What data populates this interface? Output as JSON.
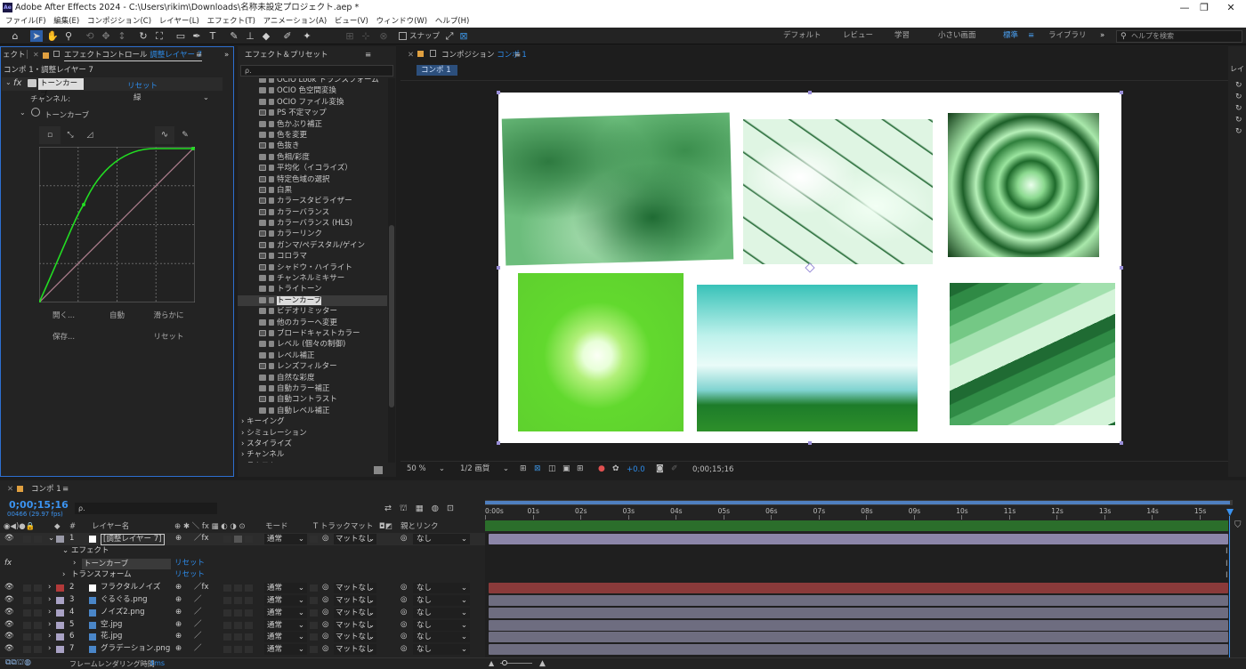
{
  "app": {
    "title": "Adobe After Effects 2024 - C:\\Users\\rikim\\Downloads\\名称未設定プロジェクト.aep *",
    "logo": "Ae"
  },
  "menu": [
    "ファイル(F)",
    "編集(E)",
    "コンポジション(C)",
    "レイヤー(L)",
    "エフェクト(T)",
    "アニメーション(A)",
    "ビュー(V)",
    "ウィンドウ(W)",
    "ヘルプ(H)"
  ],
  "toolbar": {
    "snap_label": "スナップ",
    "workspaces": [
      "デフォルト",
      "レビュー",
      "学習",
      "小さい画面",
      "標準",
      "ライブラリ"
    ],
    "search_placeholder": "ヘルプを検索",
    "more": "»"
  },
  "effect_controls": {
    "tab_prefix": "エフェクトコントロール",
    "tab_layer": "調整レイヤー 7",
    "menu_glyph": "≡",
    "left_tab": "ェクト",
    "collapse": "»",
    "breadcrumb": "コンポ 1・調整レイヤー 7",
    "effect_name": "トーンカーブ",
    "reset": "リセット",
    "channel_label": "チャンネル:",
    "channel_value": "緑",
    "curve_label": "トーンカーブ",
    "btn_open": "開く...",
    "btn_auto": "自動",
    "btn_smooth": "滑らかに",
    "btn_save": "保存...",
    "btn_reset": "リセット"
  },
  "effects_presets": {
    "title": "エフェクト＆プリセット",
    "search_placeholder": "ρ.",
    "items": [
      {
        "name": "OCIO Look トランスフォーム",
        "icon": "effect-32bit"
      },
      {
        "name": "OCIO 色空間変換",
        "icon": "effect-32bit"
      },
      {
        "name": "OCIO ファイル変換",
        "icon": "effect-32bit"
      },
      {
        "name": "PS 不定マップ",
        "icon": "effect-8bit"
      },
      {
        "name": "色かぶり補正",
        "icon": "effect-32bit"
      },
      {
        "name": "色を変更",
        "icon": "effect-32bit"
      },
      {
        "name": "色抜き",
        "icon": "effect-8bit"
      },
      {
        "name": "色相/彩度",
        "icon": "effect-32bit"
      },
      {
        "name": "平均化（イコライズ）",
        "icon": "effect-8bit"
      },
      {
        "name": "特定色域の選択",
        "icon": "effect-8bit"
      },
      {
        "name": "白黒",
        "icon": "effect-8bit"
      },
      {
        "name": "カラースタビライザー",
        "icon": "effect-8bit"
      },
      {
        "name": "カラーバランス",
        "icon": "effect-8bit"
      },
      {
        "name": "カラーバランス (HLS)",
        "icon": "effect-32bit"
      },
      {
        "name": "カラーリンク",
        "icon": "effect-8bit"
      },
      {
        "name": "ガンマ/ペデスタル/ゲイン",
        "icon": "effect-8bit"
      },
      {
        "name": "コロラマ",
        "icon": "effect-8bit"
      },
      {
        "name": "シャドウ・ハイライト",
        "icon": "effect-8bit"
      },
      {
        "name": "チャンネルミキサー",
        "icon": "effect-32bit"
      },
      {
        "name": "トライトーン",
        "icon": "effect-32bit"
      },
      {
        "name": "トーンカーブ",
        "icon": "effect-32bit",
        "selected": true
      },
      {
        "name": "ビデオリミッター",
        "icon": "effect-32bit"
      },
      {
        "name": "他のカラーへ変更",
        "icon": "effect-32bit"
      },
      {
        "name": "ブロードキャストカラー",
        "icon": "effect-8bit"
      },
      {
        "name": "レベル (個々の制御)",
        "icon": "effect-32bit"
      },
      {
        "name": "レベル補正",
        "icon": "effect-32bit"
      },
      {
        "name": "レンズフィルター",
        "icon": "effect-8bit"
      },
      {
        "name": "自然な彩度",
        "icon": "effect-32bit"
      },
      {
        "name": "自動カラー補正",
        "icon": "effect-32bit"
      },
      {
        "name": "自動コントラスト",
        "icon": "effect-8bit"
      },
      {
        "name": "自動レベル補正",
        "icon": "effect-32bit"
      }
    ],
    "categories": [
      "キーイング",
      "シミュレーション",
      "スタイライズ",
      "チャンネル",
      "テキスト"
    ]
  },
  "composition": {
    "tab_prefix": "コンポジション",
    "tab_name": "コンポ 1",
    "menu_glyph": "≡",
    "comp_tab": "コンポ 1",
    "zoom": "50 %",
    "resolution": "1/2 画質",
    "exposure": "+0.0",
    "timecode": "0;00;15;16",
    "right_tab": "レイ"
  },
  "timeline": {
    "comp": "コンポ 1",
    "timecode": "0;00;15;16",
    "frame_info": "00466 (29.97 fps)",
    "search_placeholder": "ρ.",
    "col_layer": "レイヤー名",
    "col_mode": "モード",
    "col_trackmatte": "T トラックマット",
    "col_parent": "親とリンク",
    "col_switches": "⊕ ✱ ＼ fx ▦ ◐ ◑ ⊙",
    "col_num": "#",
    "ticks": [
      "0:00s",
      "01s",
      "02s",
      "03s",
      "04s",
      "05s",
      "06s",
      "07s",
      "08s",
      "09s",
      "10s",
      "11s",
      "12s",
      "13s",
      "14s",
      "15s"
    ],
    "layers": [
      {
        "num": "1",
        "name": "[調整レイヤー 7]",
        "color": "#9a9aa8",
        "mode": "通常",
        "matte": "マットなし",
        "parent": "なし",
        "bar": "#8b85a8",
        "selected": true
      },
      {
        "num": "2",
        "name": "フラクタルノイズ",
        "color": "#b23a3a",
        "mode": "通常",
        "matte": "マットなし",
        "parent": "なし",
        "bar": "#8a3a3a"
      },
      {
        "num": "3",
        "name": "ぐるぐる.png",
        "color": "#a9a2c5",
        "mode": "通常",
        "matte": "マットなし",
        "parent": "なし",
        "bar": "#6e6d80"
      },
      {
        "num": "4",
        "name": "ノイズ2.png",
        "color": "#a9a2c5",
        "mode": "通常",
        "matte": "マットなし",
        "parent": "なし",
        "bar": "#6e6d80"
      },
      {
        "num": "5",
        "name": "空.jpg",
        "color": "#a9a2c5",
        "mode": "通常",
        "matte": "マットなし",
        "parent": "なし",
        "bar": "#6e6d80"
      },
      {
        "num": "6",
        "name": "花.jpg",
        "color": "#a9a2c5",
        "mode": "通常",
        "matte": "マットなし",
        "parent": "なし",
        "bar": "#6e6d80"
      },
      {
        "num": "7",
        "name": "グラデーション.png",
        "color": "#a9a2c5",
        "mode": "通常",
        "matte": "マットなし",
        "parent": "なし",
        "bar": "#6e6d80"
      }
    ],
    "effect_group": "エフェクト",
    "effect_item": "トーンカーブ",
    "transform": "トランスフォーム",
    "reset": "リセット",
    "footer_label": "フレームレンダリング時間",
    "footer_value": "4ms"
  }
}
